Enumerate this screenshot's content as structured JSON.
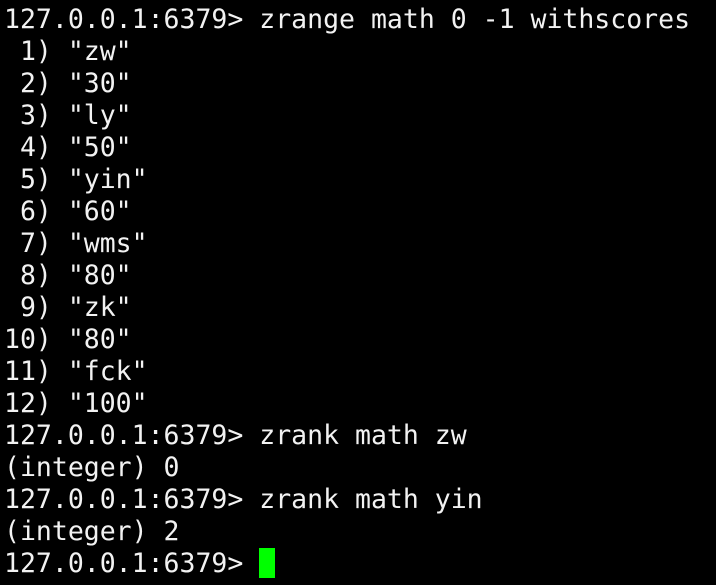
{
  "terminal": {
    "lines": [
      "127.0.0.1:6379> zrange math 0 -1 withscores",
      " 1) \"zw\"",
      " 2) \"30\"",
      " 3) \"ly\"",
      " 4) \"50\"",
      " 5) \"yin\"",
      " 6) \"60\"",
      " 7) \"wms\"",
      " 8) \"80\"",
      " 9) \"zk\"",
      "10) \"80\"",
      "11) \"fck\"",
      "12) \"100\"",
      "127.0.0.1:6379> zrank math zw",
      "(integer) 0",
      "127.0.0.1:6379> zrank math yin",
      "(integer) 2"
    ],
    "prompt": "127.0.0.1:6379> ",
    "cursor_color": "#00ff00",
    "text_color": "#f2f2f2",
    "background_color": "#000000"
  }
}
